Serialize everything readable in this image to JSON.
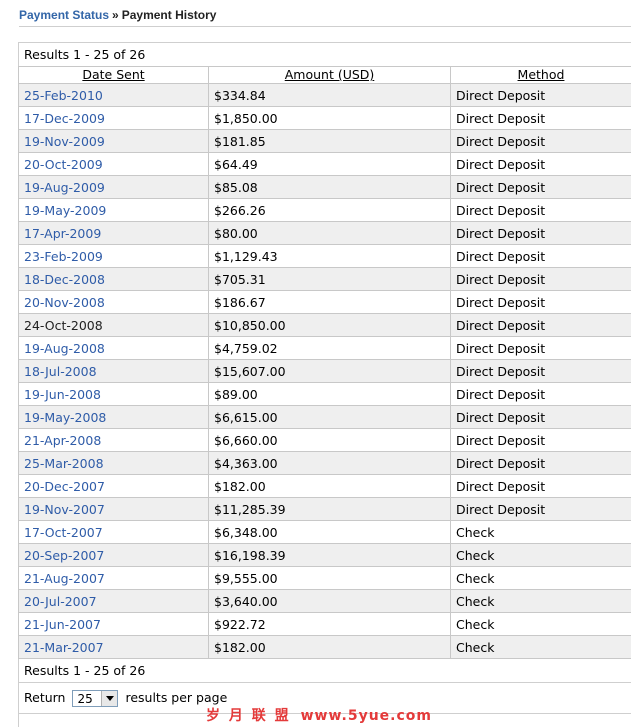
{
  "breadcrumb": {
    "parent": "Payment Status",
    "separator": "»",
    "current": "Payment History"
  },
  "results_top": "Results 1 - 25 of 26",
  "results_bottom": "Results 1 - 25 of 26",
  "columns": {
    "date": "Date Sent",
    "amount": "Amount (USD)",
    "method": "Method"
  },
  "rows": [
    {
      "date": "25-Feb-2010",
      "amount": "$334.84",
      "method": "Direct Deposit",
      "link": true
    },
    {
      "date": "17-Dec-2009",
      "amount": "$1,850.00",
      "method": "Direct Deposit",
      "link": true
    },
    {
      "date": "19-Nov-2009",
      "amount": "$181.85",
      "method": "Direct Deposit",
      "link": true
    },
    {
      "date": "20-Oct-2009",
      "amount": "$64.49",
      "method": "Direct Deposit",
      "link": true
    },
    {
      "date": "19-Aug-2009",
      "amount": "$85.08",
      "method": "Direct Deposit",
      "link": true
    },
    {
      "date": "19-May-2009",
      "amount": "$266.26",
      "method": "Direct Deposit",
      "link": true
    },
    {
      "date": "17-Apr-2009",
      "amount": "$80.00",
      "method": "Direct Deposit",
      "link": true
    },
    {
      "date": "23-Feb-2009",
      "amount": "$1,129.43",
      "method": "Direct Deposit",
      "link": true
    },
    {
      "date": "18-Dec-2008",
      "amount": "$705.31",
      "method": "Direct Deposit",
      "link": true
    },
    {
      "date": "20-Nov-2008",
      "amount": "$186.67",
      "method": "Direct Deposit",
      "link": true
    },
    {
      "date": "24-Oct-2008",
      "amount": "$10,850.00",
      "method": "Direct Deposit",
      "link": false
    },
    {
      "date": "19-Aug-2008",
      "amount": "$4,759.02",
      "method": "Direct Deposit",
      "link": true
    },
    {
      "date": "18-Jul-2008",
      "amount": "$15,607.00",
      "method": "Direct Deposit",
      "link": true
    },
    {
      "date": "19-Jun-2008",
      "amount": "$89.00",
      "method": "Direct Deposit",
      "link": true
    },
    {
      "date": "19-May-2008",
      "amount": "$6,615.00",
      "method": "Direct Deposit",
      "link": true
    },
    {
      "date": "21-Apr-2008",
      "amount": "$6,660.00",
      "method": "Direct Deposit",
      "link": true
    },
    {
      "date": "25-Mar-2008",
      "amount": "$4,363.00",
      "method": "Direct Deposit",
      "link": true
    },
    {
      "date": "20-Dec-2007",
      "amount": "$182.00",
      "method": "Direct Deposit",
      "link": true
    },
    {
      "date": "19-Nov-2007",
      "amount": "$11,285.39",
      "method": "Direct Deposit",
      "link": true
    },
    {
      "date": "17-Oct-2007",
      "amount": "$6,348.00",
      "method": "Check",
      "link": true
    },
    {
      "date": "20-Sep-2007",
      "amount": "$16,198.39",
      "method": "Check",
      "link": true
    },
    {
      "date": "21-Aug-2007",
      "amount": "$9,555.00",
      "method": "Check",
      "link": true
    },
    {
      "date": "20-Jul-2007",
      "amount": "$3,640.00",
      "method": "Check",
      "link": true
    },
    {
      "date": "21-Jun-2007",
      "amount": "$922.72",
      "method": "Check",
      "link": true
    },
    {
      "date": "21-Mar-2007",
      "amount": "$182.00",
      "method": "Check",
      "link": true
    }
  ],
  "pager": {
    "return_label": "Return",
    "per_page_value": "25",
    "suffix": "results per page"
  },
  "watermark": {
    "chars": "岁 月 联 盟",
    "url": "www.5yue.com"
  },
  "colors": {
    "link": "#2f5ca8",
    "breadcrumb_link": "#3366a8",
    "row_alt": "#efefef",
    "watermark": "#e43a3a"
  }
}
